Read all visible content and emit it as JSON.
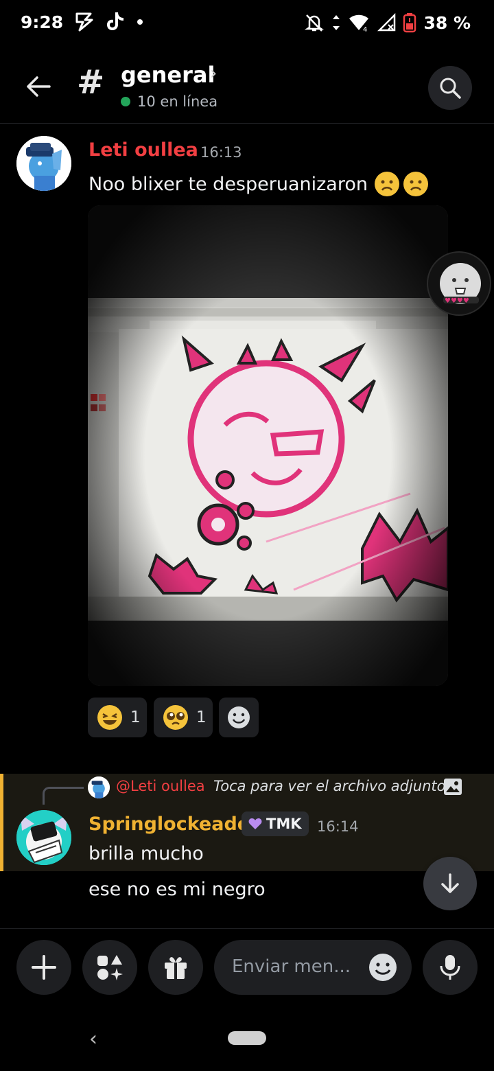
{
  "status_bar": {
    "time": "9:28",
    "battery_percent": "38 %"
  },
  "header": {
    "channel_name": "general",
    "online": "10 en línea"
  },
  "messages": [
    {
      "author": "Leti oullea",
      "author_color": "#f23f42",
      "time": "16:13",
      "text": "Noo blixer te desperuanizaron",
      "reactions": [
        {
          "emoji": "laughing-face",
          "count": "1"
        },
        {
          "emoji": "pleading-face",
          "count": "1"
        }
      ]
    },
    {
      "reply": {
        "mention": "@Leti oullea",
        "text": "Toca para ver el archivo adjunto"
      },
      "author": "Springlockeado",
      "author_color": "#f0b232",
      "role_tag": "TMK",
      "time": "16:14",
      "lines": [
        "brilla mucho",
        "ese no es mi negro"
      ]
    }
  ],
  "composer": {
    "placeholder": "Enviar men..."
  },
  "colors": {
    "accent_mention": "#f0b232",
    "online": "#23a55a",
    "background": "#000000"
  }
}
